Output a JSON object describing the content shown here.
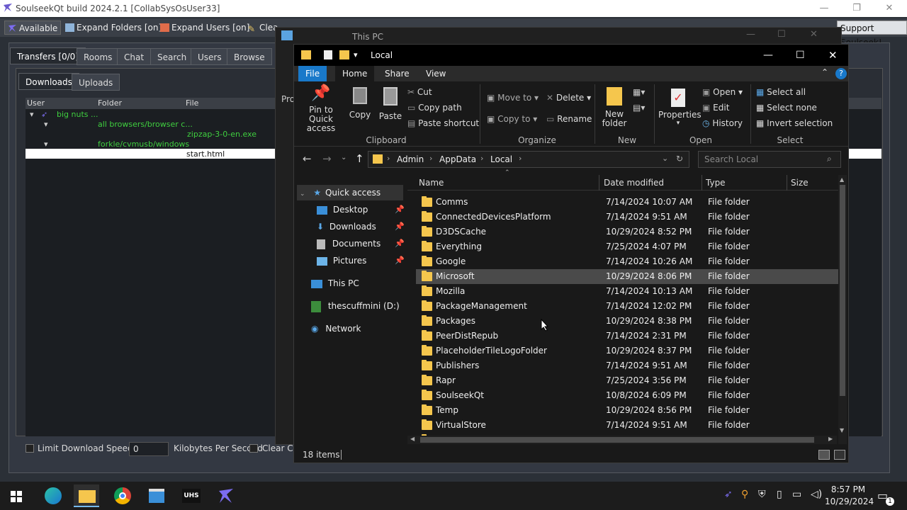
{
  "soulseek": {
    "title": "SoulseekQt build 2024.2.1 [CollabSysOsUser33]",
    "toolbar": {
      "available": "Available",
      "expand_folders": "Expand Folders [on]",
      "expand_users": "Expand Users [on]",
      "clear": "Clea",
      "support": "Support Soulseek!"
    },
    "tabs": [
      "Transfers [0/0]",
      "Rooms",
      "Chat",
      "Search",
      "Users",
      "Browse"
    ],
    "subtabs": [
      "Downloads",
      "Uploads"
    ],
    "columns": {
      "user": "User",
      "folder": "Folder",
      "file": "File"
    },
    "rows": {
      "user": "big nuts ...",
      "folder1": "all browsers/browser c...",
      "file1": "zipzap-3-0-en.exe",
      "folder2": "forkle/cvmusb/windows",
      "file2": "start.html"
    },
    "bottom": {
      "limit_label": "Limit Download Speed to",
      "limit_value": "0",
      "unit": "Kilobytes Per Second",
      "clear": "Clear Co"
    }
  },
  "explorer_back": {
    "title": "This PC",
    "side_label": "Pro"
  },
  "explorer": {
    "title": "Local",
    "ribbon_tabs": [
      "File",
      "Home",
      "Share",
      "View"
    ],
    "clipboard": {
      "pin": "Pin to Quick access",
      "copy": "Copy",
      "paste": "Paste",
      "cut": "Cut",
      "copy_path": "Copy path",
      "paste_shortcut": "Paste shortcut",
      "group": "Clipboard"
    },
    "organize": {
      "move_to": "Move to",
      "copy_to": "Copy to",
      "delete": "Delete",
      "rename": "Rename",
      "group": "Organize"
    },
    "new": {
      "new_folder": "New folder",
      "group": "New"
    },
    "open": {
      "properties": "Properties",
      "open": "Open",
      "edit": "Edit",
      "history": "History",
      "group": "Open"
    },
    "select": {
      "select_all": "Select all",
      "select_none": "Select none",
      "invert": "Invert selection",
      "group": "Select"
    },
    "breadcrumb": [
      "Admin",
      "AppData",
      "Local"
    ],
    "search_placeholder": "Search Local",
    "nav": {
      "quick_access": "Quick access",
      "desktop": "Desktop",
      "downloads": "Downloads",
      "documents": "Documents",
      "pictures": "Pictures",
      "this_pc": "This PC",
      "drive": "thescuffmini (D:)",
      "network": "Network"
    },
    "columns": {
      "name": "Name",
      "date": "Date modified",
      "type": "Type",
      "size": "Size"
    },
    "files": [
      {
        "name": "Comms",
        "date": "7/14/2024 10:07 AM",
        "type": "File folder"
      },
      {
        "name": "ConnectedDevicesPlatform",
        "date": "7/14/2024 9:51 AM",
        "type": "File folder"
      },
      {
        "name": "D3DSCache",
        "date": "10/29/2024 8:52 PM",
        "type": "File folder"
      },
      {
        "name": "Everything",
        "date": "7/25/2024 4:07 PM",
        "type": "File folder"
      },
      {
        "name": "Google",
        "date": "7/14/2024 10:26 AM",
        "type": "File folder"
      },
      {
        "name": "Microsoft",
        "date": "10/29/2024 8:06 PM",
        "type": "File folder"
      },
      {
        "name": "Mozilla",
        "date": "7/14/2024 10:13 AM",
        "type": "File folder"
      },
      {
        "name": "PackageManagement",
        "date": "7/14/2024 12:02 PM",
        "type": "File folder"
      },
      {
        "name": "Packages",
        "date": "10/29/2024 8:38 PM",
        "type": "File folder"
      },
      {
        "name": "PeerDistRepub",
        "date": "7/14/2024 2:31 PM",
        "type": "File folder"
      },
      {
        "name": "PlaceholderTileLogoFolder",
        "date": "10/29/2024 8:37 PM",
        "type": "File folder"
      },
      {
        "name": "Publishers",
        "date": "7/14/2024 9:51 AM",
        "type": "File folder"
      },
      {
        "name": "Rapr",
        "date": "7/25/2024 3:56 PM",
        "type": "File folder"
      },
      {
        "name": "SoulseekQt",
        "date": "10/8/2024 6:09 PM",
        "type": "File folder"
      },
      {
        "name": "Temp",
        "date": "10/29/2024 8:56 PM",
        "type": "File folder"
      },
      {
        "name": "VirtualStore",
        "date": "7/14/2024 9:51 AM",
        "type": "File folder"
      }
    ],
    "status": "18 items"
  },
  "taskbar": {
    "time": "8:57 PM",
    "date": "10/29/2024",
    "uhs": "UHS",
    "notif_count": "1"
  }
}
